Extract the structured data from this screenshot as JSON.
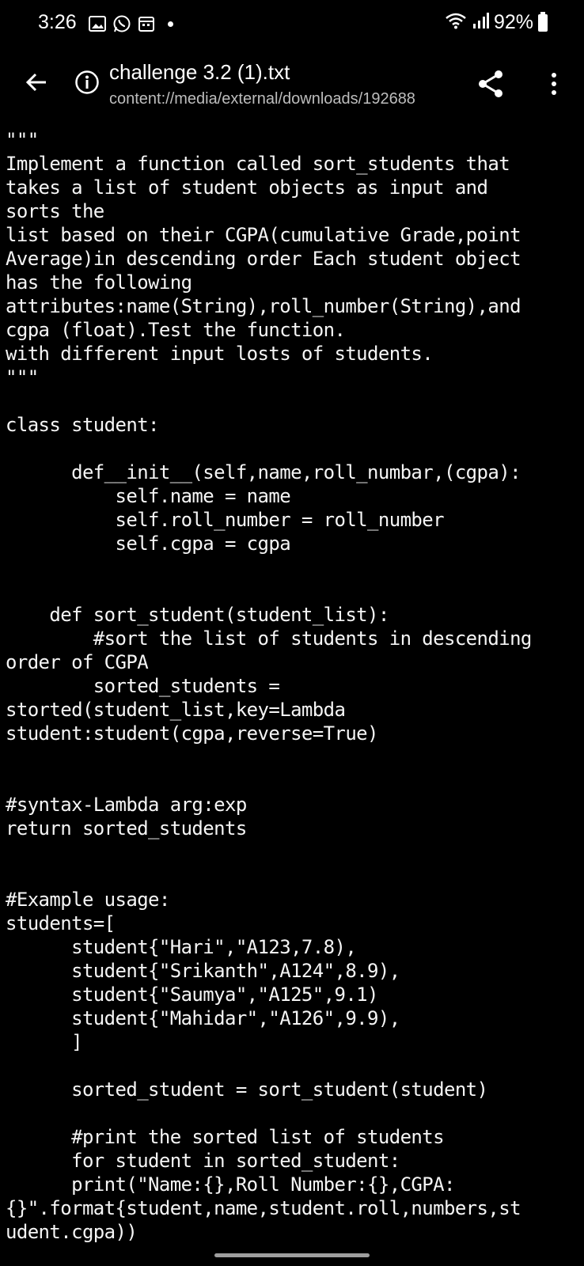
{
  "status_bar": {
    "time": "3:26",
    "battery": "92%",
    "icons": [
      "gallery-icon",
      "whatsapp-icon",
      "calendar-icon",
      "notification-dot",
      "wifi-icon",
      "signal-icon",
      "battery-icon"
    ]
  },
  "app_bar": {
    "title": "challenge 3.2 (1).txt",
    "path": "content://media/external/downloads/192688",
    "icons": [
      "back-arrow-icon",
      "info-icon",
      "share-icon",
      "more-vertical-icon"
    ]
  },
  "file_lines": [
    "\"\"\"",
    "Implement a function called sort_students that",
    "takes a list of student objects as input and",
    "sorts the",
    "list based on their CGPA(cumulative Grade,point",
    "Average)in descending order Each student object",
    "has the following",
    "attributes:name(String),roll_number(String),and",
    "cgpa (float).Test the function.",
    "with different input losts of students.",
    "\"\"\"",
    "",
    "class student:",
    "",
    "      def__init__(self,name,roll_numbar,(cgpa):",
    "          self.name = name",
    "          self.roll_number = roll_number",
    "          self.cgpa = cgpa",
    "",
    "",
    "    def sort_student(student_list):",
    "        #sort the list of students in descending",
    "order of CGPA",
    "        sorted_students =",
    "storted(student_list,key=Lambda",
    "student:student(cgpa,reverse=True)",
    "",
    "",
    "#syntax-Lambda arg:exp",
    "return sorted_students",
    "",
    "",
    "#Example usage:",
    "students=[",
    "      student{\"Hari\",\"A123,7.8),",
    "      student{\"Srikanth\",A124\",8.9),",
    "      student{\"Saumya\",\"A125\",9.1)",
    "      student{\"Mahidar\",\"A126\",9.9),",
    "      ]",
    "",
    "      sorted_student = sort_student(student)",
    "",
    "      #print the sorted list of students",
    "      for student in sorted_student:",
    "      print(\"Name:{},Roll Number:{},CGPA:",
    "{}\".format{student,name,student.roll,numbers,st",
    "udent.cgpa))"
  ]
}
